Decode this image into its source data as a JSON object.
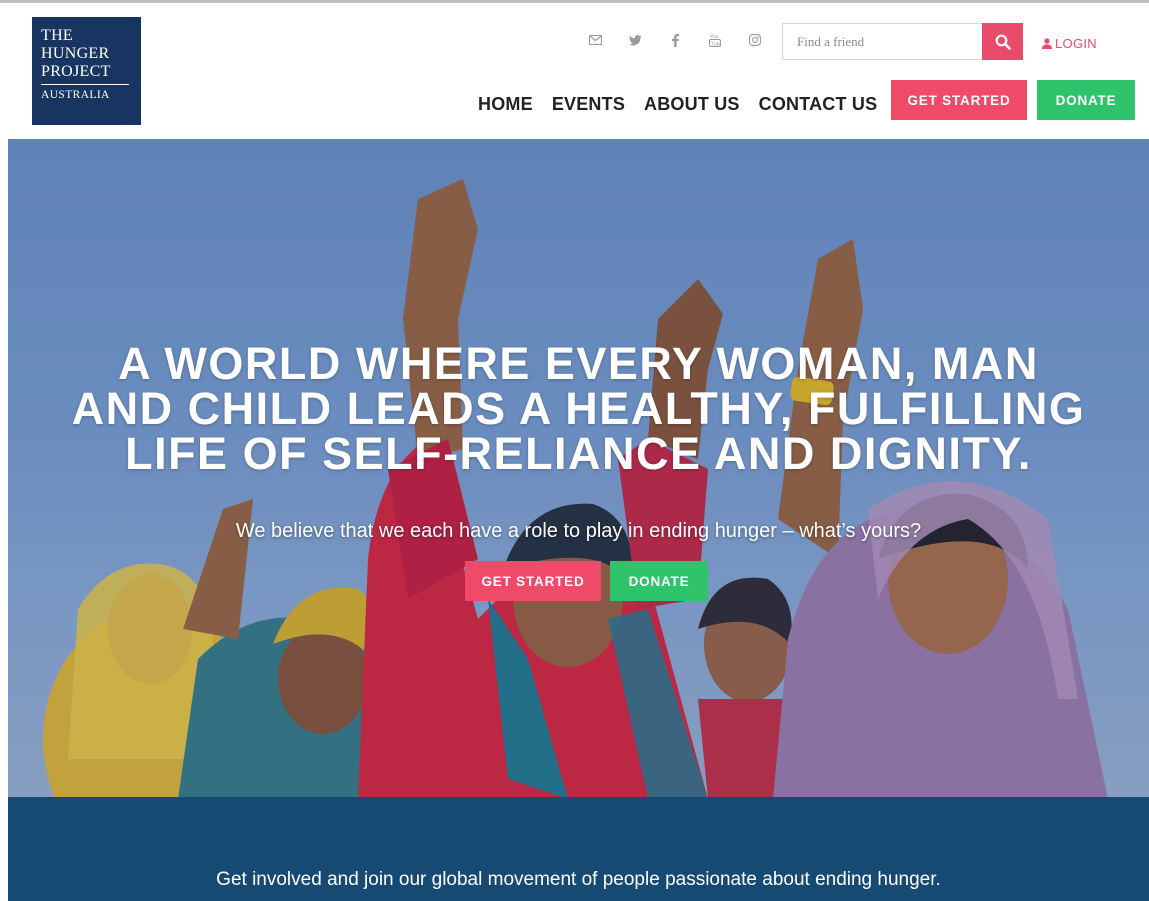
{
  "logo": {
    "line1": "THE",
    "line2": "HUNGER",
    "line3": "PROJECT",
    "line4": "AUSTRALIA"
  },
  "social_icons": [
    "envelope-icon",
    "twitter-icon",
    "facebook-icon",
    "youtube-icon",
    "instagram-icon"
  ],
  "search": {
    "placeholder": "Find a friend"
  },
  "login_label": "LOGIN",
  "nav": {
    "home": "HOME",
    "events": "EVENTS",
    "about": "ABOUT US",
    "contact": "CONTACT US"
  },
  "header_buttons": {
    "get_started": "GET STARTED",
    "donate": "DONATE"
  },
  "hero": {
    "title_line1": "A WORLD WHERE EVERY WOMAN, MAN",
    "title_line2": "AND CHILD LEADS A HEALTHY, FULFILLING",
    "title_line3": "LIFE OF SELF-RELIANCE AND DIGNITY.",
    "subtitle": "We believe that we each have a role to play in ending hunger – what’s yours?",
    "get_started": "GET STARTED",
    "donate": "DONATE"
  },
  "band": {
    "text": "Get involved and join our global movement of people passionate about ending hunger."
  },
  "colors": {
    "brand_navy": "#173560",
    "accent_pink": "#ef4a68",
    "accent_green": "#2fc46b",
    "band_blue": "#174a73"
  }
}
